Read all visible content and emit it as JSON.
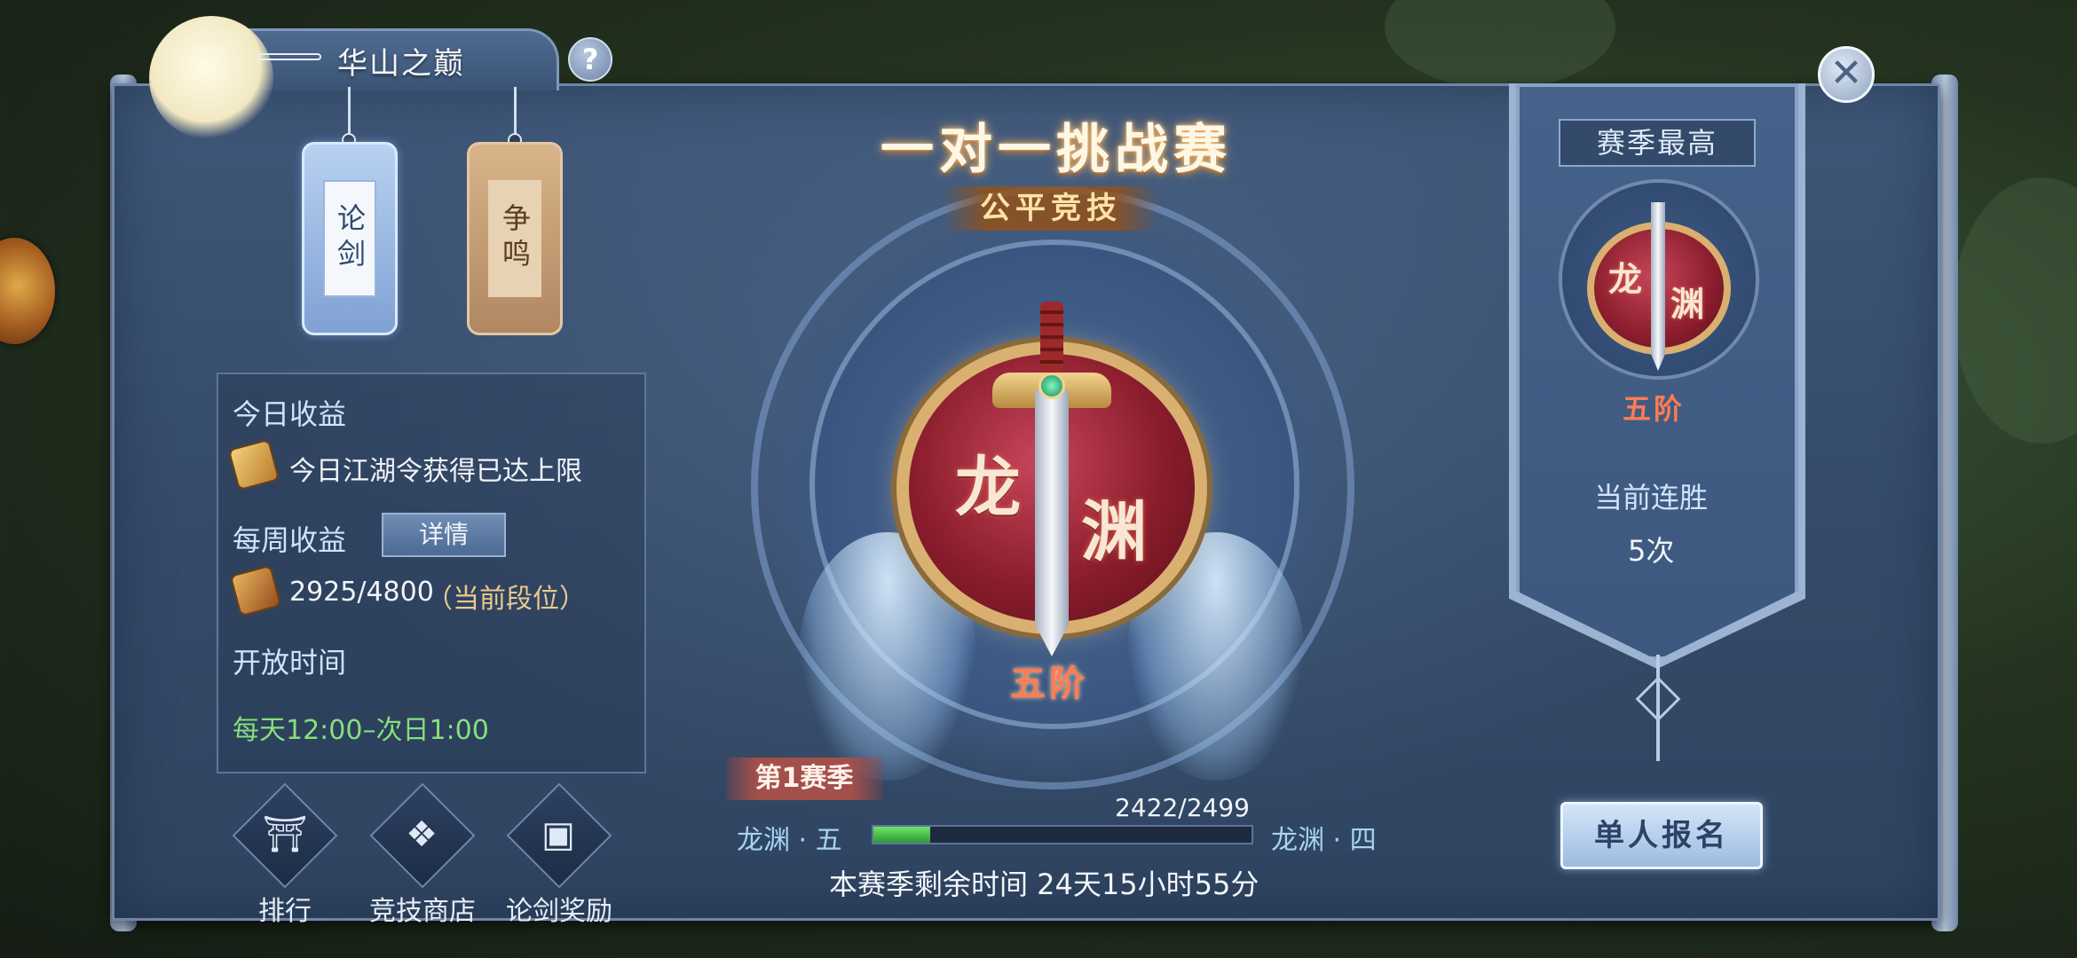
{
  "window": {
    "title": "华山之巅",
    "help_icon": "?",
    "close_icon": "✕"
  },
  "tabs": [
    {
      "label": "论剑",
      "selected": true
    },
    {
      "label": "争鸣",
      "selected": false
    }
  ],
  "info": {
    "today_label": "今日收益",
    "today_text": "今日江湖令获得已达上限",
    "weekly_label": "每周收益",
    "detail_button": "详情",
    "weekly_value": "2925/4800",
    "weekly_note": "（当前段位）",
    "open_time_label": "开放时间",
    "open_time_value": "每天12:00–次日1:00"
  },
  "bottom_buttons": [
    {
      "label": "排行",
      "icon": "pavilion-icon"
    },
    {
      "label": "竞技商店",
      "icon": "shop-bag-icon"
    },
    {
      "label": "论剑奖励",
      "icon": "treasure-chest-icon"
    }
  ],
  "center": {
    "title": "一对一挑战赛",
    "subtitle": "公平竞技",
    "badge_chars": [
      "龙",
      "渊"
    ],
    "tier": "五阶",
    "season": "第1赛季",
    "score": "2422/2499",
    "progress_fraction": 0.15,
    "rank_current": "龙渊 · 五",
    "rank_next": "龙渊 · 四",
    "remaining": "本赛季剩余时间 24天15小时55分"
  },
  "season_best": {
    "title": "赛季最高",
    "badge_chars": [
      "龙",
      "渊"
    ],
    "tier": "五阶",
    "streak_label": "当前连胜",
    "streak_value": "5次",
    "signup_button": "单人报名"
  },
  "colors": {
    "panel": "#3f5778",
    "accent_green": "#86e07a",
    "tier_red": "#ff7b54",
    "gold": "#d9b070"
  }
}
